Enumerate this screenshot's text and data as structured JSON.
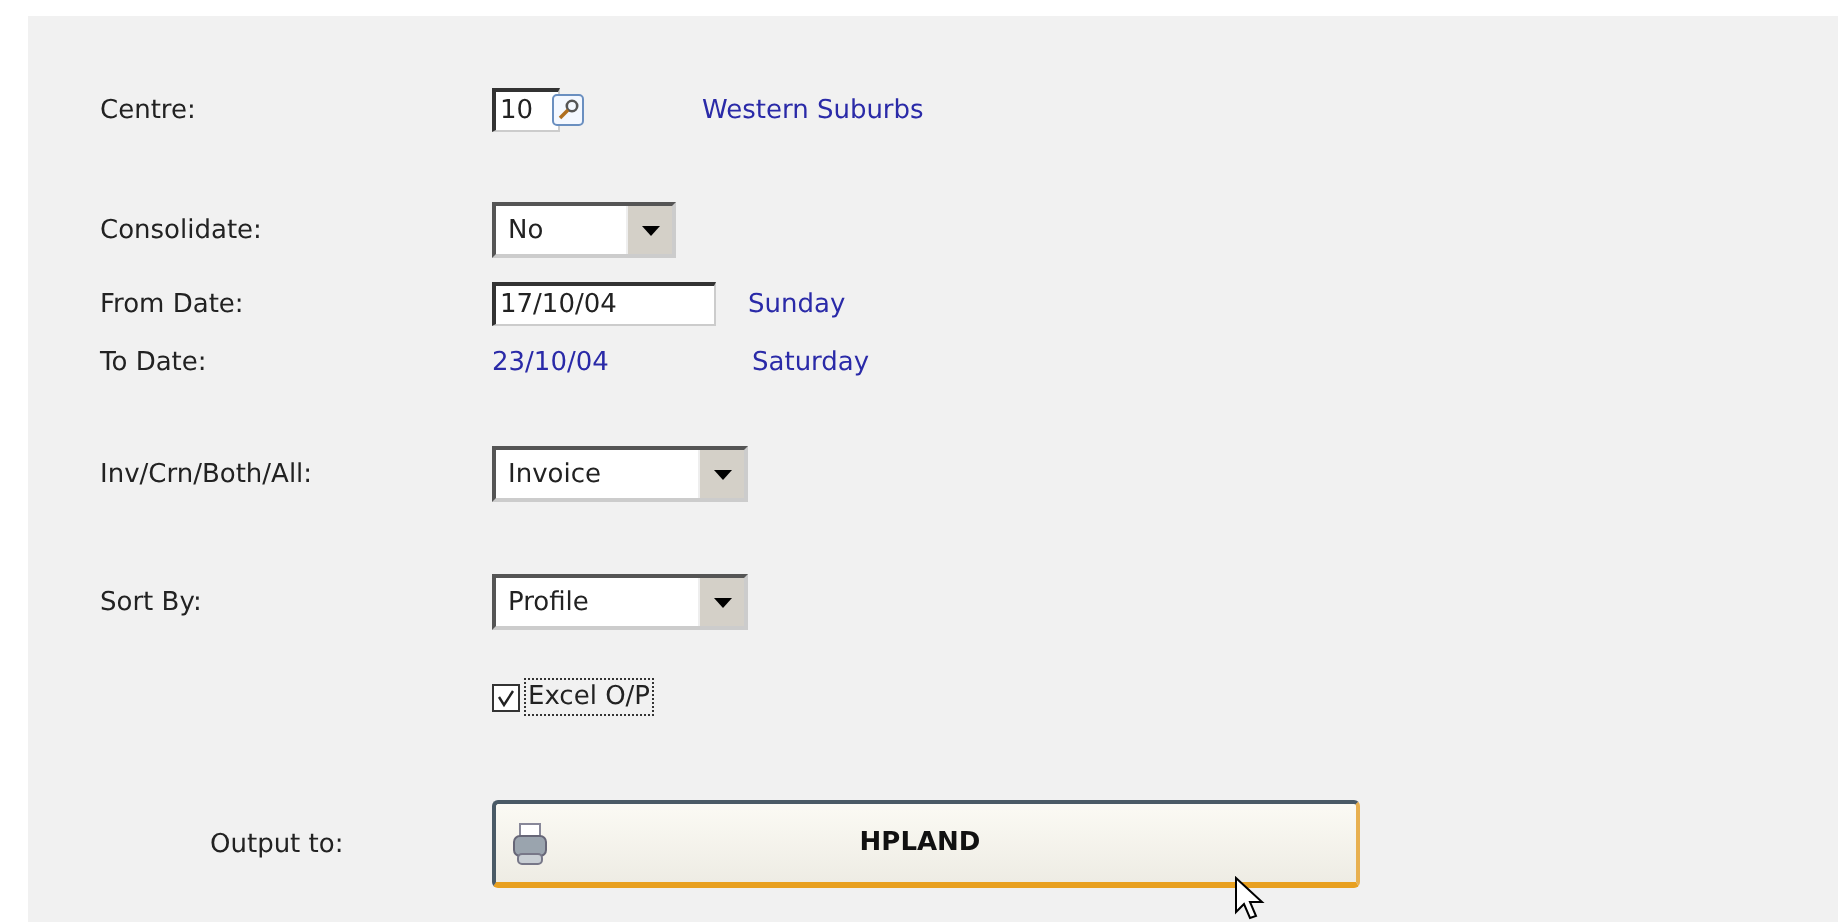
{
  "fields": [
    {
      "kind": "lookup",
      "label": "Centre:",
      "value": "10",
      "note": "Western Suburbs"
    },
    {
      "kind": "select",
      "label": "Consolidate:",
      "value": "No"
    },
    {
      "kind": "date",
      "label": "From Date:",
      "value": "17/10/04",
      "note": "Sunday"
    },
    {
      "kind": "text",
      "label": "To Date:",
      "value": "23/10/04",
      "note": "Saturday"
    },
    {
      "kind": "select",
      "label": "Inv/Crn/Both/All:",
      "value": "Invoice"
    },
    {
      "kind": "select",
      "label": "Sort By:",
      "value": "Profile"
    },
    {
      "kind": "checkbox",
      "label": "Excel O/P",
      "checked": true
    }
  ],
  "output": {
    "label": "Output to:",
    "printer": "HPLAND"
  }
}
